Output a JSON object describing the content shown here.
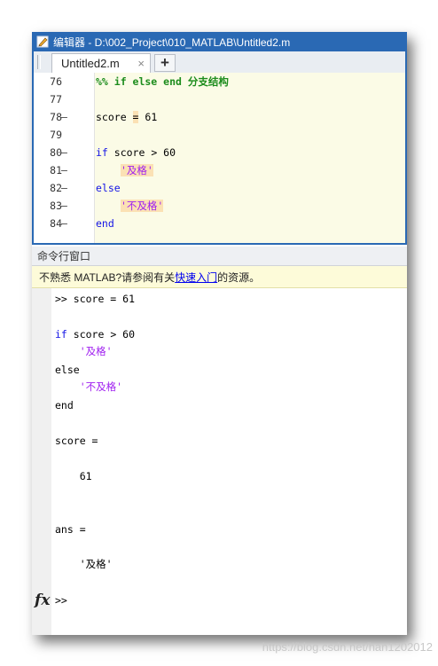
{
  "window": {
    "title": "编辑器 - D:\\002_Project\\010_MATLAB\\Untitled2.m"
  },
  "tabs": {
    "active_label": "Untitled2.m",
    "close_glyph": "×",
    "add_glyph": "+"
  },
  "editor": {
    "lines": [
      {
        "num": "76",
        "dash": ""
      },
      {
        "num": "77",
        "dash": ""
      },
      {
        "num": "78",
        "dash": "–"
      },
      {
        "num": "79",
        "dash": ""
      },
      {
        "num": "80",
        "dash": "–"
      },
      {
        "num": "81",
        "dash": "–"
      },
      {
        "num": "82",
        "dash": "–"
      },
      {
        "num": "83",
        "dash": "–"
      },
      {
        "num": "84",
        "dash": "–"
      }
    ],
    "code": {
      "cell_title": "%% if else end 分支结构",
      "score_var": "score ",
      "eq": "=",
      "score_val": " 61",
      "if_kw": "if",
      "if_cond": " score > 60",
      "str_pass": "'及格'",
      "else_kw": "else",
      "str_fail": "'不及格'",
      "end_kw": "end"
    }
  },
  "command_window": {
    "header": "命令行窗口",
    "notice_prefix": "不熟悉 MATLAB?请参阅有关",
    "notice_link": "快速入门",
    "notice_suffix": "的资源。",
    "lines": {
      "l1": ">> score = 61",
      "l2_kw": "if",
      "l2_rest": " score > 60",
      "l3": "    '及格'",
      "l4": "else",
      "l5": "    '不及格'",
      "l6": "end",
      "l7": "score =",
      "l8": "    61",
      "l9": "ans =",
      "l10": "    '及格'",
      "prompt": ">>"
    },
    "fx_label": "fx"
  },
  "watermark": "https://blog.csdn.net/han1202012",
  "colors": {
    "titlebar": "#2a69b4",
    "keyword": "#1414e6",
    "string": "#a020f0",
    "cell_title": "#1c8c1c",
    "editor_bg": "#fbfbe6"
  }
}
